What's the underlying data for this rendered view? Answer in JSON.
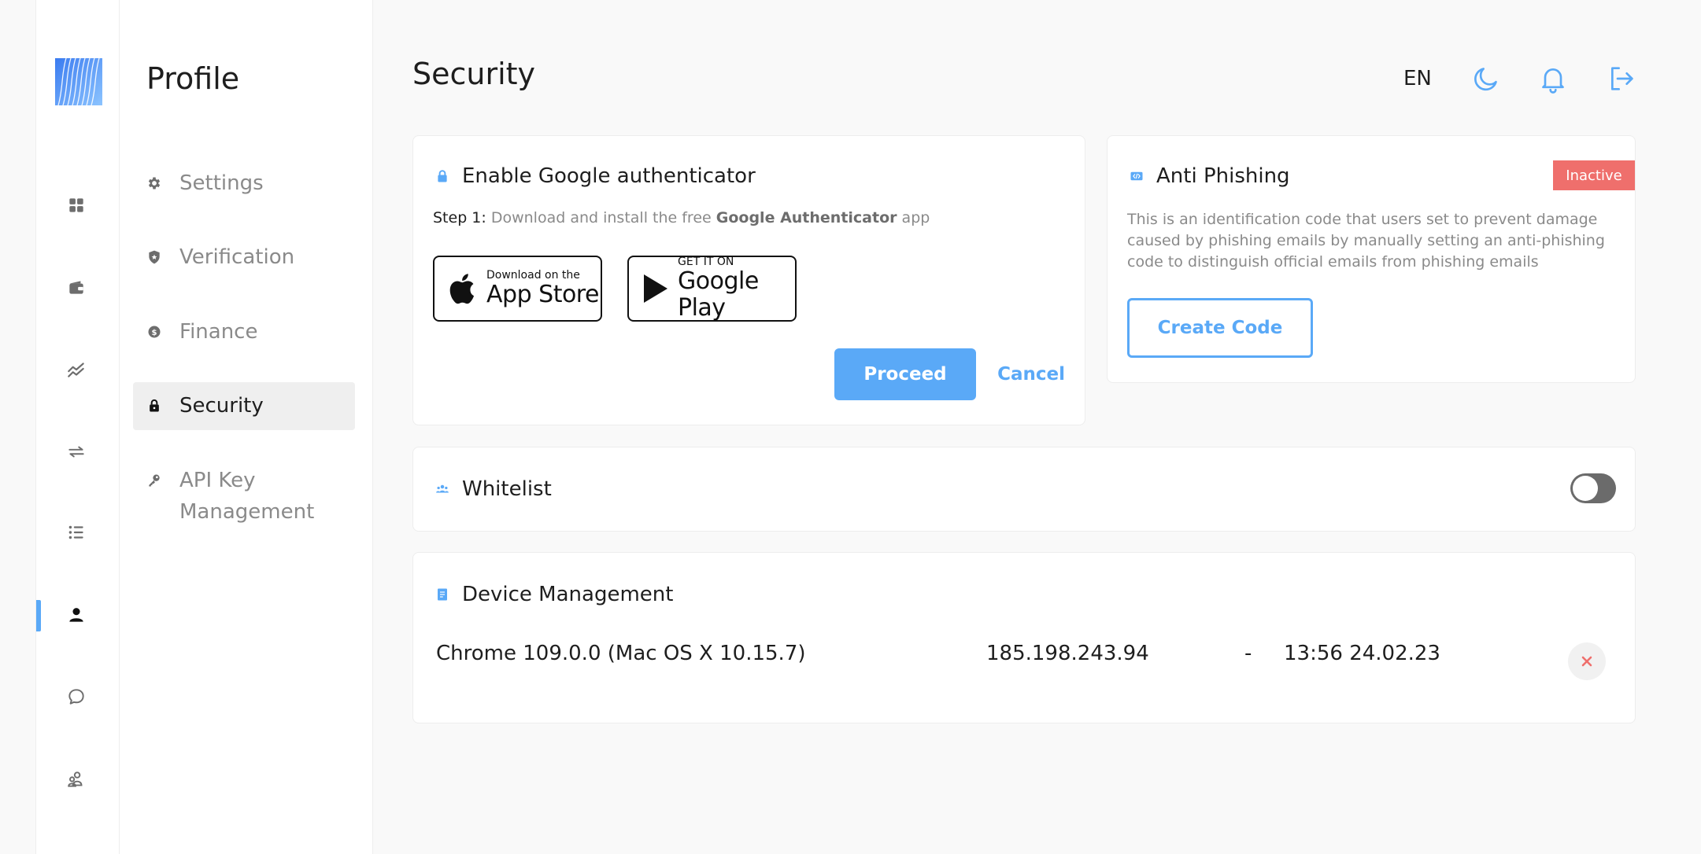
{
  "rail": {
    "items": [
      {
        "name": "dashboard",
        "icon": "grid-icon"
      },
      {
        "name": "wallet",
        "icon": "wallet-icon"
      },
      {
        "name": "markets",
        "icon": "trend-icon"
      },
      {
        "name": "exchange",
        "icon": "swap-icon"
      },
      {
        "name": "orders",
        "icon": "list-icon"
      },
      {
        "name": "profile",
        "icon": "user-icon",
        "active": true
      },
      {
        "name": "support",
        "icon": "chat-icon"
      },
      {
        "name": "referral",
        "icon": "users-icon"
      }
    ]
  },
  "menu": {
    "title": "Profile",
    "items": [
      {
        "label": "Settings",
        "icon": "gear-icon"
      },
      {
        "label": "Verification",
        "icon": "shield-icon"
      },
      {
        "label": "Finance",
        "icon": "coin-icon"
      },
      {
        "label": "Security",
        "icon": "lock-icon",
        "active": true
      },
      {
        "label_line1": "API Key",
        "label_line2": "Management",
        "icon": "key-icon"
      }
    ]
  },
  "header": {
    "title": "Security",
    "language": "EN"
  },
  "google_auth": {
    "title": "Enable Google authenticator",
    "step_label": "Step 1:",
    "step_text_before": " Download and install the free ",
    "step_text_bold": "Google Authenticator",
    "step_text_after": " app",
    "app_store_small": "Download on the",
    "app_store_big": "App Store",
    "google_play_small": "GET IT ON",
    "google_play_big": "Google Play",
    "proceed_label": "Proceed",
    "cancel_label": "Cancel"
  },
  "anti_phishing": {
    "title": "Anti Phishing",
    "status": "Inactive",
    "description": "This is an identification code that users set to prevent damage caused by phishing emails by manually setting an anti-phishing code to distinguish official emails from phishing emails",
    "create_label": "Create Code"
  },
  "whitelist": {
    "title": "Whitelist",
    "enabled": false
  },
  "device_management": {
    "title": "Device Management",
    "devices": [
      {
        "browser": "Chrome 109.0.0 (Mac OS X 10.15.7)",
        "ip": "185.198.243.94",
        "location": "-",
        "time": "13:56 24.02.23"
      }
    ]
  },
  "colors": {
    "accent": "#5aa9f7",
    "danger": "#ef6f6c",
    "text": "#1e1e1e",
    "muted": "#8a8a8a"
  }
}
